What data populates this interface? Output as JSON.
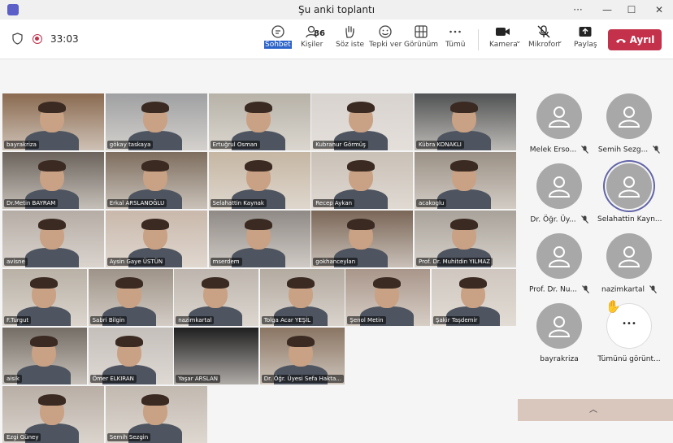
{
  "window": {
    "title": "Şu anki toplantı",
    "minimize": "—",
    "maximize": "☐",
    "close": "✕",
    "more": "···"
  },
  "toolbar": {
    "timer": "33:03",
    "chat": "Sohbet",
    "people": "Kişiler",
    "people_count": "86",
    "raise_hand": "Söz iste",
    "reactions": "Tepki ver",
    "view": "Görünüm",
    "more": "Tümü",
    "camera": "Kamera",
    "mic": "Mikrofon",
    "share": "Paylaş",
    "leave": "Ayrıl"
  },
  "grid": [
    {
      "name": "bayrakriza",
      "bg": "#8a6a50"
    },
    {
      "name": "gökay taskaya",
      "bg": "#9fa0a2"
    },
    {
      "name": "Ertuğrul Osman",
      "bg": "#b7b2a8"
    },
    {
      "name": "Kubranur Görmüş",
      "bg": "#d8d3cf"
    },
    {
      "name": "Kübra KONAKLI",
      "bg": "#505253"
    },
    {
      "name": "Dr.Metin BAYRAM",
      "bg": "#6b635c"
    },
    {
      "name": "Erkal ARSLANOĞLU",
      "bg": "#7d6d5e"
    },
    {
      "name": "Selahattin Kaynak",
      "bg": "#c5b6a3"
    },
    {
      "name": "Recep Aykan",
      "bg": "#c9c0b6"
    },
    {
      "name": "acakoglu",
      "bg": "#9a9085"
    },
    {
      "name": "avisne",
      "bg": "#b5aca5"
    },
    {
      "name": "Aysin Gaye ÜSTÜN",
      "bg": "#c9b8ab"
    },
    {
      "name": "mserdem",
      "bg": "#8f8a85"
    },
    {
      "name": "gokhanceylan",
      "bg": "#7a6657"
    },
    {
      "name": "Prof. Dr. Muhitdin YILMAZ",
      "bg": "#a8a29a"
    },
    {
      "name": "F.Turgut",
      "bg": "#b9b1a6"
    },
    {
      "name": "Sabri Bilgin",
      "bg": "#9e9388"
    },
    {
      "name": "nazimkartal",
      "bg": "#bdb5ad"
    },
    {
      "name": "Tolga Acar YEŞİL",
      "bg": "#b3aaa0"
    },
    {
      "name": "Şenol Metin",
      "bg": "#a9968a"
    },
    {
      "name": "Şakir Taşdemir",
      "bg": "#cfc7bf"
    },
    {
      "name": "aisik",
      "bg": "#746d65"
    },
    {
      "name": "Ömer ELKIRAN",
      "bg": "#c4bfba"
    },
    {
      "name": "Yaşar ARSLAN",
      "bg": "#1f1f1f"
    },
    {
      "name": "Dr. Öğr. Üyesi Sefa Hakta...",
      "bg": "#8a7563"
    },
    {
      "name": "Ezgi Güney",
      "bg": "#b8aea5"
    },
    {
      "name": "Semih Sezgin",
      "bg": "#c2b9b0"
    }
  ],
  "side_participants": [
    {
      "name": "Melek Erso..."
    },
    {
      "name": "Semih Sezg..."
    },
    {
      "name": "Dr. Öğr. Üy..."
    },
    {
      "name": "Selahattin Kayn..."
    },
    {
      "name": "Prof. Dr. Nu..."
    },
    {
      "name": "nazimkartal"
    },
    {
      "name": "bayrakriza"
    }
  ],
  "show_all": "Tümünü görünt...",
  "more_dots": "•••",
  "bottom_chevron": "︿",
  "colors": {
    "leave": "#c4314b",
    "accent": "#6264a7",
    "chat_highlight": "#2b63c9"
  }
}
